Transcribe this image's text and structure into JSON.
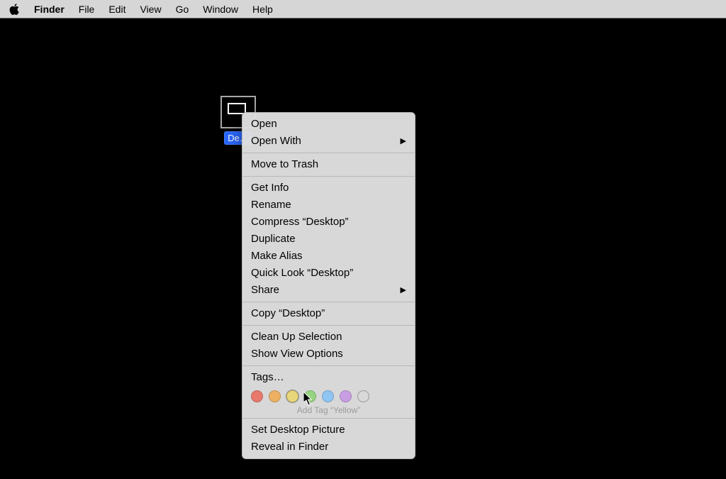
{
  "menubar": {
    "app_name": "Finder",
    "items": [
      "File",
      "Edit",
      "View",
      "Go",
      "Window",
      "Help"
    ]
  },
  "desktop_icon": {
    "label": "De…"
  },
  "context_menu": {
    "sections": [
      [
        {
          "label": "Open",
          "submenu": false
        },
        {
          "label": "Open With",
          "submenu": true
        }
      ],
      [
        {
          "label": "Move to Trash",
          "submenu": false
        }
      ],
      [
        {
          "label": "Get Info",
          "submenu": false
        },
        {
          "label": "Rename",
          "submenu": false
        },
        {
          "label": "Compress “Desktop”",
          "submenu": false
        },
        {
          "label": "Duplicate",
          "submenu": false
        },
        {
          "label": "Make Alias",
          "submenu": false
        },
        {
          "label": "Quick Look “Desktop”",
          "submenu": false
        },
        {
          "label": "Share",
          "submenu": true
        }
      ],
      [
        {
          "label": "Copy “Desktop”",
          "submenu": false
        }
      ],
      [
        {
          "label": "Clean Up Selection",
          "submenu": false
        },
        {
          "label": "Show View Options",
          "submenu": false
        }
      ],
      [
        {
          "label": "Tags…",
          "submenu": false
        }
      ],
      [
        {
          "label": "Set Desktop Picture",
          "submenu": false
        },
        {
          "label": "Reveal in Finder",
          "submenu": false
        }
      ]
    ],
    "tags": {
      "colors": [
        {
          "name": "Red",
          "hex": "#e8796d"
        },
        {
          "name": "Orange",
          "hex": "#edb063"
        },
        {
          "name": "Yellow",
          "hex": "#e9d77b",
          "selected": true
        },
        {
          "name": "Green",
          "hex": "#97d481"
        },
        {
          "name": "Blue",
          "hex": "#8fc5f2"
        },
        {
          "name": "Purple",
          "hex": "#c99ee3"
        },
        {
          "name": "Gray",
          "hex": ""
        }
      ],
      "hint": "Add Tag “Yellow”"
    }
  }
}
